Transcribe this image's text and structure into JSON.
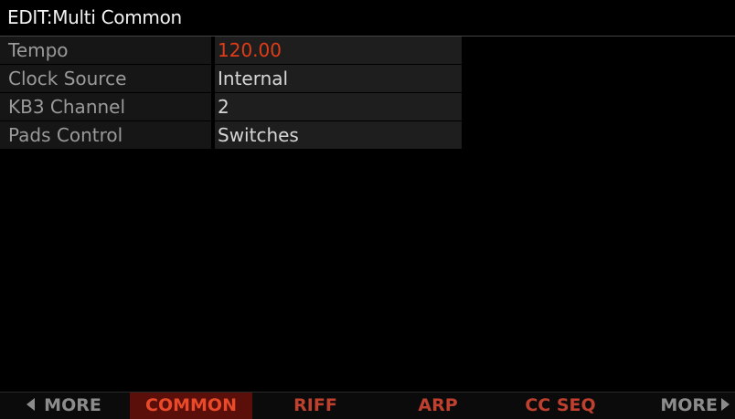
{
  "header": {
    "title": "EDIT:Multi Common"
  },
  "params": [
    {
      "label": "Tempo",
      "value": "120.00",
      "selected": true
    },
    {
      "label": "Clock Source",
      "value": "Internal",
      "selected": false
    },
    {
      "label": "KB3 Channel",
      "value": "2",
      "selected": false
    },
    {
      "label": "Pads Control",
      "value": "Switches",
      "selected": false
    }
  ],
  "softbuttons": {
    "more_left": "MORE",
    "common": "COMMON",
    "riff": "RIFF",
    "arp": "ARP",
    "ccseq": "CC SEQ",
    "more_right": "MORE",
    "active": "COMMON"
  },
  "colors": {
    "selected_value": "#e03c18",
    "active_tab_bg": "#5a0f0a",
    "tab_text": "#c04030"
  },
  "icons": {
    "left_nav": "triangle-left-icon",
    "right_nav": "triangle-right-icon"
  }
}
